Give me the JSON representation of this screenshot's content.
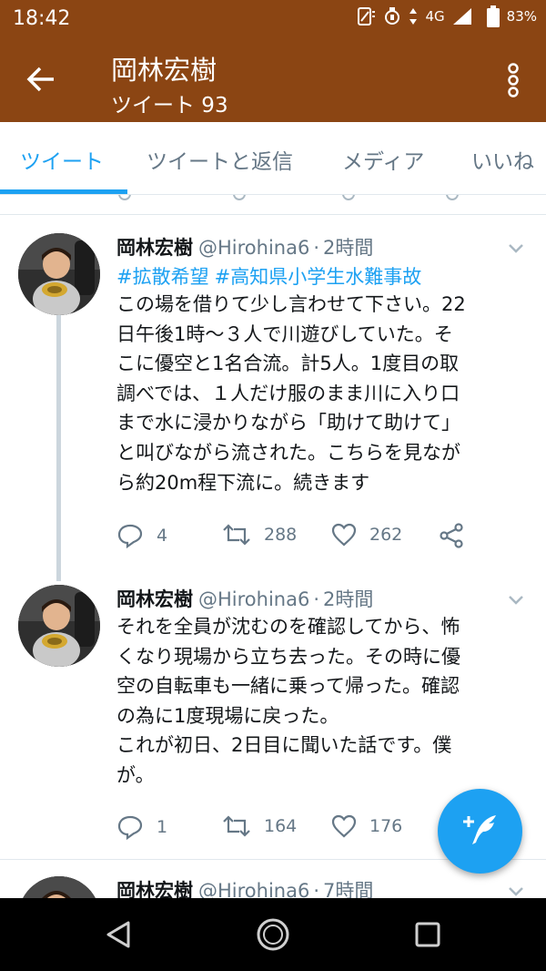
{
  "status_bar": {
    "time": "18:42",
    "network": "4G",
    "battery": "83%"
  },
  "header": {
    "title": "岡林宏樹",
    "subtitle": "ツイート 93"
  },
  "tabs": [
    {
      "label": "ツイート",
      "active": true
    },
    {
      "label": "ツイートと返信",
      "active": false
    },
    {
      "label": "メディア",
      "active": false
    },
    {
      "label": "いいね",
      "active": false
    }
  ],
  "tweets": [
    {
      "name": "岡林宏樹",
      "handle": "@Hirohina6",
      "time": "2時間",
      "hashtags": [
        "#拡散希望",
        "#高知県小学生水難事故"
      ],
      "body": "この場を借りて少し言わせて下さい。22\n日午後1時～３人で川遊びしていた。そ\nこに優空と1名合流。計5人。1度目の取\n調べでは、１人だけ服のまま川に入り口\nまで水に浸かりながら「助けて助けて」\nと叫びながら流された。こちらを見なが\nら約20m程下流に。続きます",
      "replies": "4",
      "retweets": "288",
      "likes": "262"
    },
    {
      "name": "岡林宏樹",
      "handle": "@Hirohina6",
      "time": "2時間",
      "body": "それを全員が沈むのを確認してから、怖\nくなり現場から立ち去った。その時に優\n空の自転車も一緒に乗って帰った。確認\nの為に1度現場に戻った。\nこれが初日、2日目に聞いた話です。僕\nが。",
      "replies": "1",
      "retweets": "164",
      "likes": "176"
    },
    {
      "name": "岡林宏樹",
      "handle": "@Hirohina6",
      "time": "7時間"
    }
  ],
  "colors": {
    "header_bg": "#8b4513",
    "accent": "#1da1f2",
    "muted": "#657786"
  },
  "icons": {
    "back": "arrow-left-icon",
    "more": "more-vertical-icon",
    "reply": "reply-icon",
    "retweet": "retweet-icon",
    "like": "heart-icon",
    "share": "share-icon",
    "compose": "compose-tweet-icon"
  }
}
